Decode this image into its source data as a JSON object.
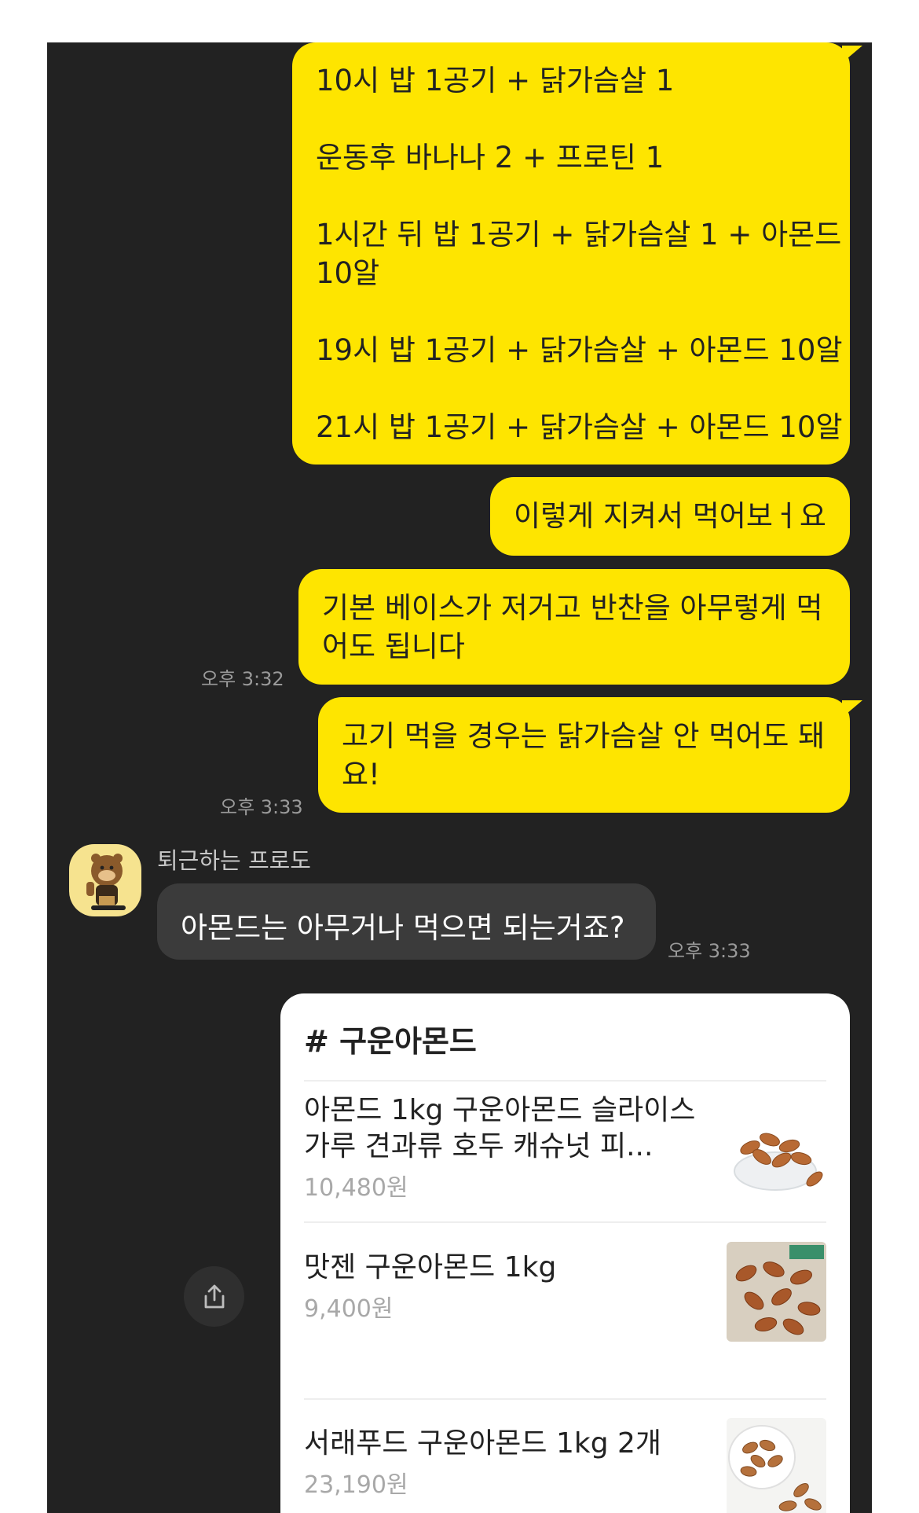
{
  "sent_block": {
    "lines": [
      "10시 밥 1공기 + 닭가슴살 1",
      "운동후 바나나 2 + 프로틴 1",
      "1시간 뒤 밥 1공기 + 닭가슴살 1 + 아몬드",
      "10알",
      "19시 밥 1공기 + 닭가슴살 + 아몬드 10알",
      "21시 밥 1공기 + 닭가슴살 + 아몬드 10알"
    ]
  },
  "sent_messages": [
    {
      "text": "이렇게 지켜서 먹어보ㅓ요",
      "time": ""
    },
    {
      "text": "기본 베이스가 저거고 반찬을 아무렇게 먹어도 됩니다",
      "time": "오후 3:32"
    },
    {
      "text": "고기 먹을 경우는 닭가슴살 안 먹어도 돼요!",
      "time": "오후 3:33"
    }
  ],
  "received": {
    "sender": "퇴근하는 프로도",
    "text": "아몬드는 아무거나 먹으면 되는거죠?",
    "time": "오후 3:33",
    "avatar_icon": "frodo-character-avatar"
  },
  "shopping_card": {
    "hashtag": "# 구운아몬드",
    "products": [
      {
        "name": "아몬드 1kg 구운아몬드 슬라이스 가루 견과류 호두 캐슈넛 피...",
        "price": "10,480원",
        "thumb": "almonds-in-glass-bowl"
      },
      {
        "name": "맛젠 구운아몬드 1kg",
        "price": "9,400원",
        "thumb": "almonds-on-burlap"
      },
      {
        "name": "서래푸드 구운아몬드 1kg 2개",
        "price": "23,190원",
        "thumb": "almonds-in-white-bowl"
      }
    ]
  },
  "share_button_icon": "share-icon",
  "colors": {
    "sent_bubble": "#fee500",
    "received_bubble": "#3b3b3b",
    "background": "#222222"
  }
}
